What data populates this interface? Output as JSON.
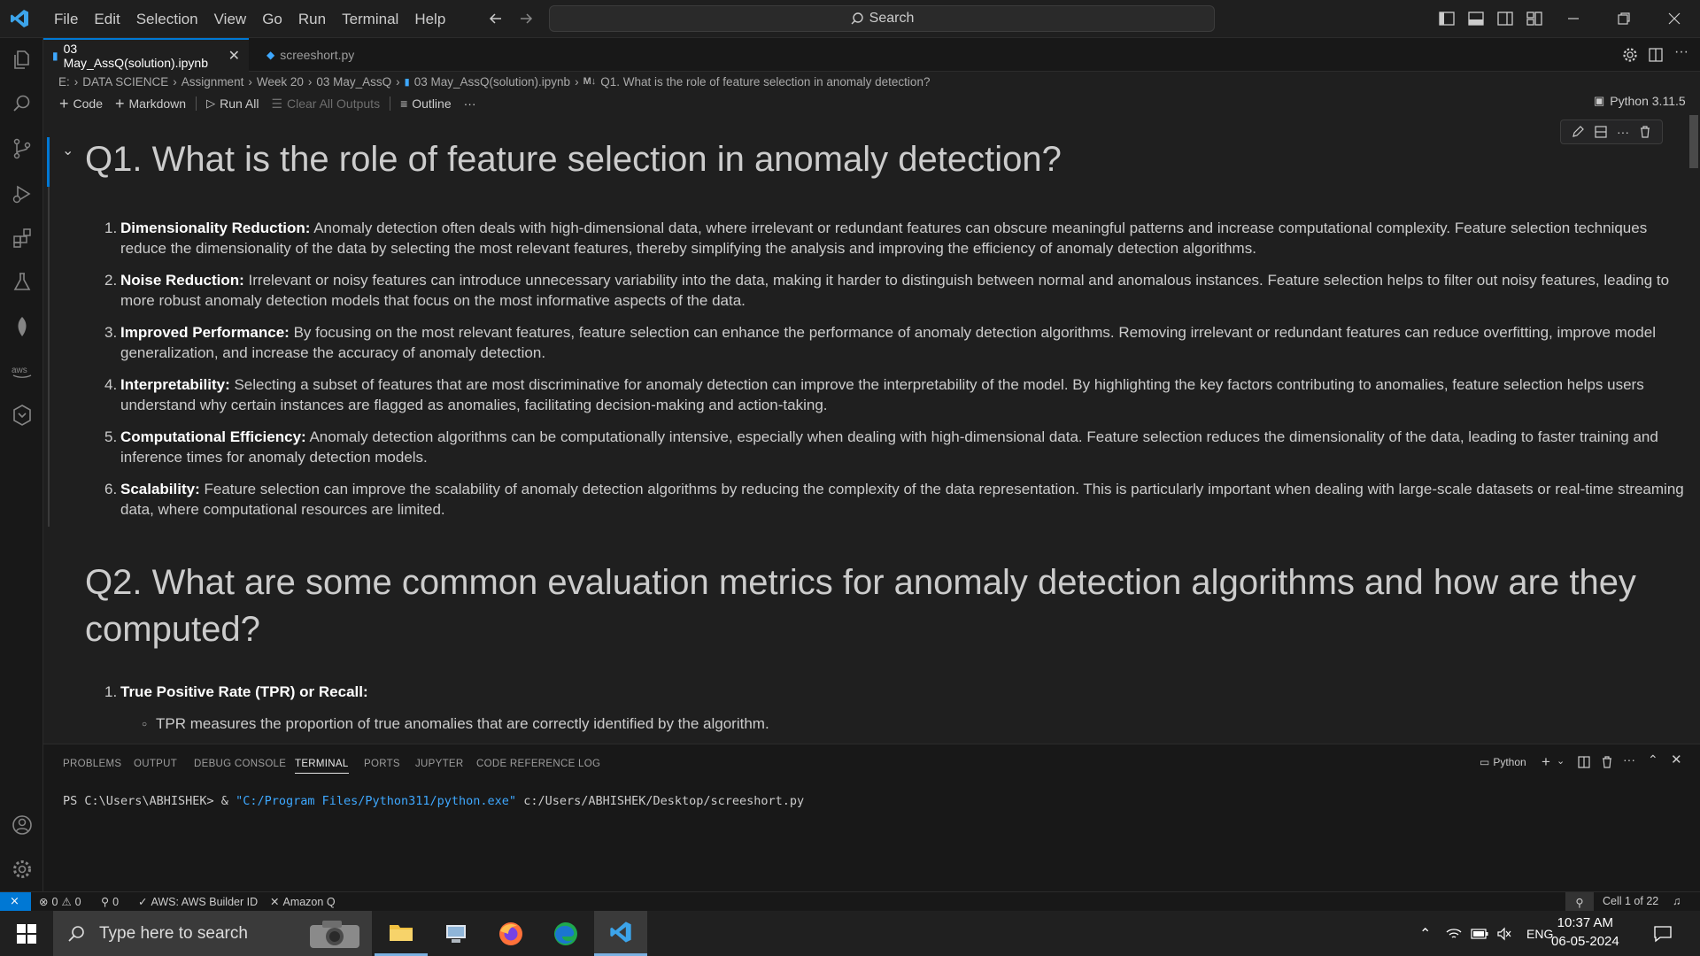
{
  "menu": [
    "File",
    "Edit",
    "Selection",
    "View",
    "Go",
    "Run",
    "Terminal",
    "Help"
  ],
  "search": {
    "label": "Search"
  },
  "tabs": [
    {
      "label": "03 May_AssQ(solution).ipynb",
      "active": true
    },
    {
      "label": "screeshort.py",
      "active": false
    }
  ],
  "breadcrumb": [
    "E:",
    "DATA SCIENCE",
    "Assignment",
    "Week 20",
    "03 May_AssQ",
    "03 May_AssQ(solution).ipynb",
    "Q1. What is the role of feature selection in anomaly detection?"
  ],
  "breadcrumb_md": "M↓",
  "notebook_toolbar": {
    "code": "Code",
    "markdown": "Markdown",
    "run_all": "Run All",
    "clear_outputs": "Clear All Outputs",
    "outline": "Outline",
    "more": "···"
  },
  "kernel": "Python 3.11.5",
  "q1": {
    "title": "Q1. What is the role of feature selection in anomaly detection?",
    "items": [
      {
        "num": "1.",
        "bold": "Dimensionality Reduction:",
        "text": " Anomaly detection often deals with high-dimensional data, where irrelevant or redundant features can obscure meaningful patterns and increase computational complexity. Feature selection techniques reduce the dimensionality of the data by selecting the most relevant features, thereby simplifying the analysis and improving the efficiency of anomaly detection algorithms."
      },
      {
        "num": "2.",
        "bold": "Noise Reduction:",
        "text": " Irrelevant or noisy features can introduce unnecessary variability into the data, making it harder to distinguish between normal and anomalous instances. Feature selection helps to filter out noisy features, leading to more robust anomaly detection models that focus on the most informative aspects of the data."
      },
      {
        "num": "3.",
        "bold": "Improved Performance:",
        "text": " By focusing on the most relevant features, feature selection can enhance the performance of anomaly detection algorithms. Removing irrelevant or redundant features can reduce overfitting, improve model generalization, and increase the accuracy of anomaly detection."
      },
      {
        "num": "4.",
        "bold": "Interpretability:",
        "text": " Selecting a subset of features that are most discriminative for anomaly detection can improve the interpretability of the model. By highlighting the key factors contributing to anomalies, feature selection helps users understand why certain instances are flagged as anomalies, facilitating decision-making and action-taking."
      },
      {
        "num": "5.",
        "bold": "Computational Efficiency:",
        "text": " Anomaly detection algorithms can be computationally intensive, especially when dealing with high-dimensional data. Feature selection reduces the dimensionality of the data, leading to faster training and inference times for anomaly detection models."
      },
      {
        "num": "6.",
        "bold": "Scalability:",
        "text": " Feature selection can improve the scalability of anomaly detection algorithms by reducing the complexity of the data representation. This is particularly important when dealing with large-scale datasets or real-time streaming data, where computational resources are limited."
      }
    ]
  },
  "q2": {
    "title": "Q2. What are some common evaluation metrics for anomaly detection algorithms and how are they computed?",
    "item1_num": "1.",
    "item1": "True Positive Rate (TPR) or Recall:",
    "sub1": "TPR measures the proportion of true anomalies that are correctly identified by the algorithm."
  },
  "panel": {
    "tabs": [
      "PROBLEMS",
      "OUTPUT",
      "DEBUG CONSOLE",
      "TERMINAL",
      "PORTS",
      "JUPYTER",
      "CODE REFERENCE LOG"
    ],
    "active_tab": "TERMINAL",
    "shell": "Python",
    "terminal": {
      "prompt": "PS C:\\Users\\ABHISHEK> & ",
      "exe": "\"C:/Program Files/Python311/python.exe\"",
      "arg": " c:/Users/ABHISHEK/Desktop/screeshort.py"
    }
  },
  "status": {
    "errors": "0",
    "warnings": "0",
    "ports": "0",
    "aws": "AWS: AWS Builder ID",
    "amazonq": "Amazon Q",
    "cell": "Cell 1 of 22"
  },
  "taskbar": {
    "search_placeholder": "Type here to search",
    "lang": "ENG",
    "time": "10:37 AM",
    "date": "06-05-2024"
  },
  "colors": {
    "accent": "#0078d4",
    "bg": "#1f1f1f",
    "terminal_string": "#3ea8ff"
  }
}
